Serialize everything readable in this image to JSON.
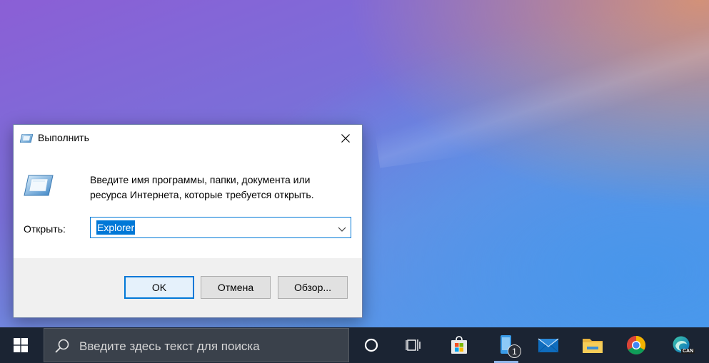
{
  "dialog": {
    "title": "Выполнить",
    "description": "Введите имя программы, папки, документа или ресурса Интернета, которые требуется открыть.",
    "open_label": "Открыть:",
    "input_value": "Explorer",
    "buttons": {
      "ok": "OK",
      "cancel": "Отмена",
      "browse": "Обзор..."
    }
  },
  "taskbar": {
    "search_placeholder": "Введите здесь текст для поиска",
    "apps": [
      {
        "name": "Cortana",
        "icon": "circle-icon"
      },
      {
        "name": "Task View",
        "icon": "task-view-icon"
      },
      {
        "name": "Microsoft Store",
        "icon": "store-icon"
      },
      {
        "name": "Phone",
        "icon": "phone-icon",
        "badge": "1"
      },
      {
        "name": "Mail",
        "icon": "mail-icon"
      },
      {
        "name": "File Explorer",
        "icon": "folder-icon"
      },
      {
        "name": "Chrome",
        "icon": "chrome-icon"
      },
      {
        "name": "Edge Canary",
        "icon": "edge-canary-icon",
        "badge": "CAN"
      }
    ]
  },
  "colors": {
    "accent": "#0078d7",
    "taskbar": "#1b2433",
    "search_bg": "#3a414b"
  }
}
